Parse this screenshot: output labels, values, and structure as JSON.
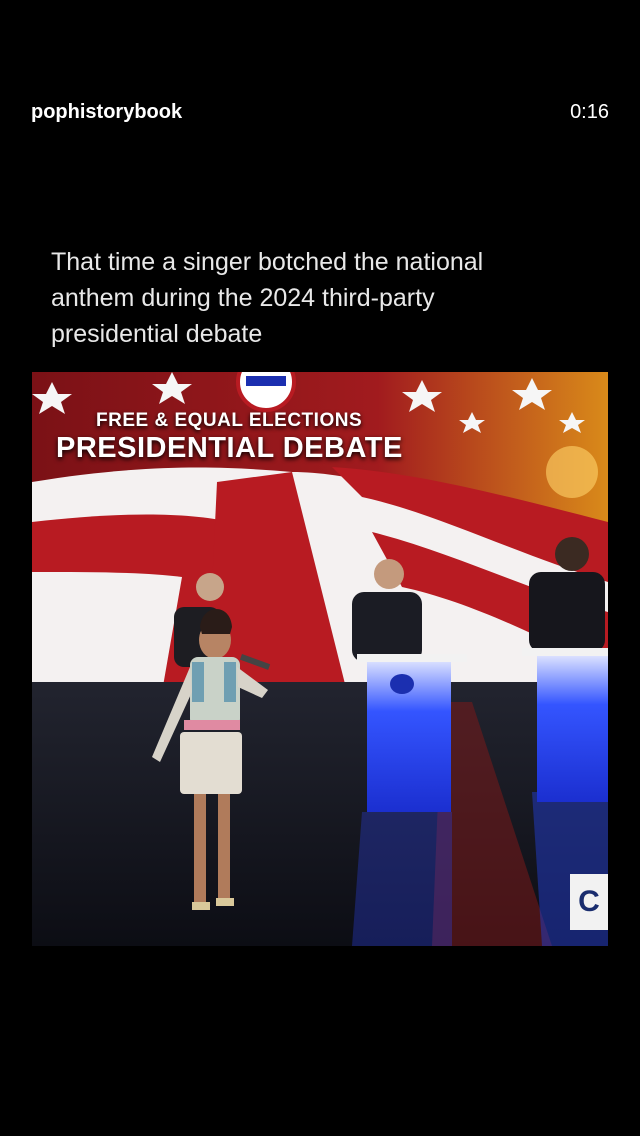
{
  "header": {
    "username": "pophistorybook",
    "timer": "0:16"
  },
  "post": {
    "caption": "That time a singer botched the national anthem during the 2024 third-party presidential debate"
  },
  "video": {
    "title_line_1": "FREE & EQUAL ELECTIONS",
    "title_line_2": "PRESIDENTIAL DEBATE",
    "channel_badge": "C"
  },
  "colors": {
    "background": "#000000",
    "flag_red": "#b81b22",
    "flag_white": "#f4f1f1",
    "podium_blue": "#2b4dff"
  }
}
